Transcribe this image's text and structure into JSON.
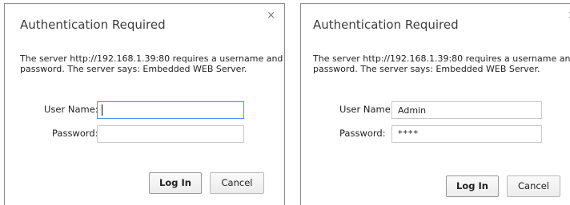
{
  "dialogs": [
    {
      "title": "Authentication Required",
      "close_glyph": "×",
      "message_line1": "The server http://192.168.1.39:80 requires a username and",
      "message_line2": "password. The server says: Embedded WEB Server.",
      "username_label": "User Name:",
      "username_value": "",
      "password_label": "Password:",
      "password_value": "",
      "login_label": "Log In",
      "cancel_label": "Cancel"
    },
    {
      "title": "Authentication Required",
      "close_glyph": "×",
      "message_line1": "The server http://192.168.1.39:80 requires a username and",
      "message_line2": "password. The server says: Embedded WEB Server.",
      "username_label": "User Name:",
      "username_value": "Admin",
      "password_label": "Password:",
      "password_value": "****",
      "login_label": "Log In",
      "cancel_label": "Cancel"
    }
  ],
  "colors": {
    "focus_border": "#4d90fe",
    "dialog_border": "#8c8c8c",
    "field_border": "#c9c9c9"
  },
  "icons": {
    "close": "close-icon"
  }
}
